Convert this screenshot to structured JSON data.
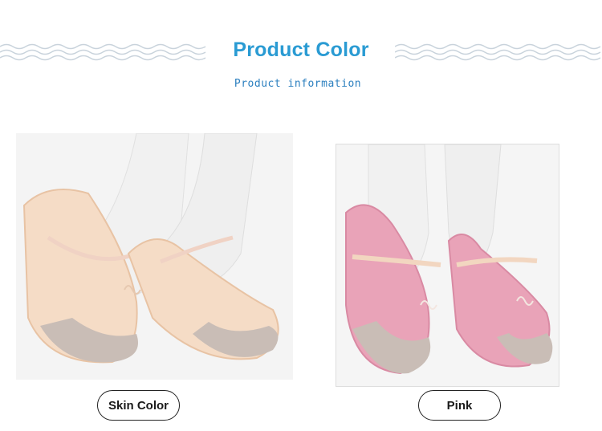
{
  "header": {
    "title": "Product Color",
    "subtitle": "Product information"
  },
  "products": [
    {
      "label": "Skin Color",
      "shoe_color": "#f5dcc6",
      "shoe_shade": "#e8c3a4"
    },
    {
      "label": "Pink",
      "shoe_color": "#e9a3b8",
      "shoe_shade": "#d98aa3"
    }
  ],
  "colors": {
    "accent": "#2a9bd3",
    "wave": "#c9d3dc",
    "tights": "#f2f2f2",
    "sole": "#c9bdb6"
  }
}
